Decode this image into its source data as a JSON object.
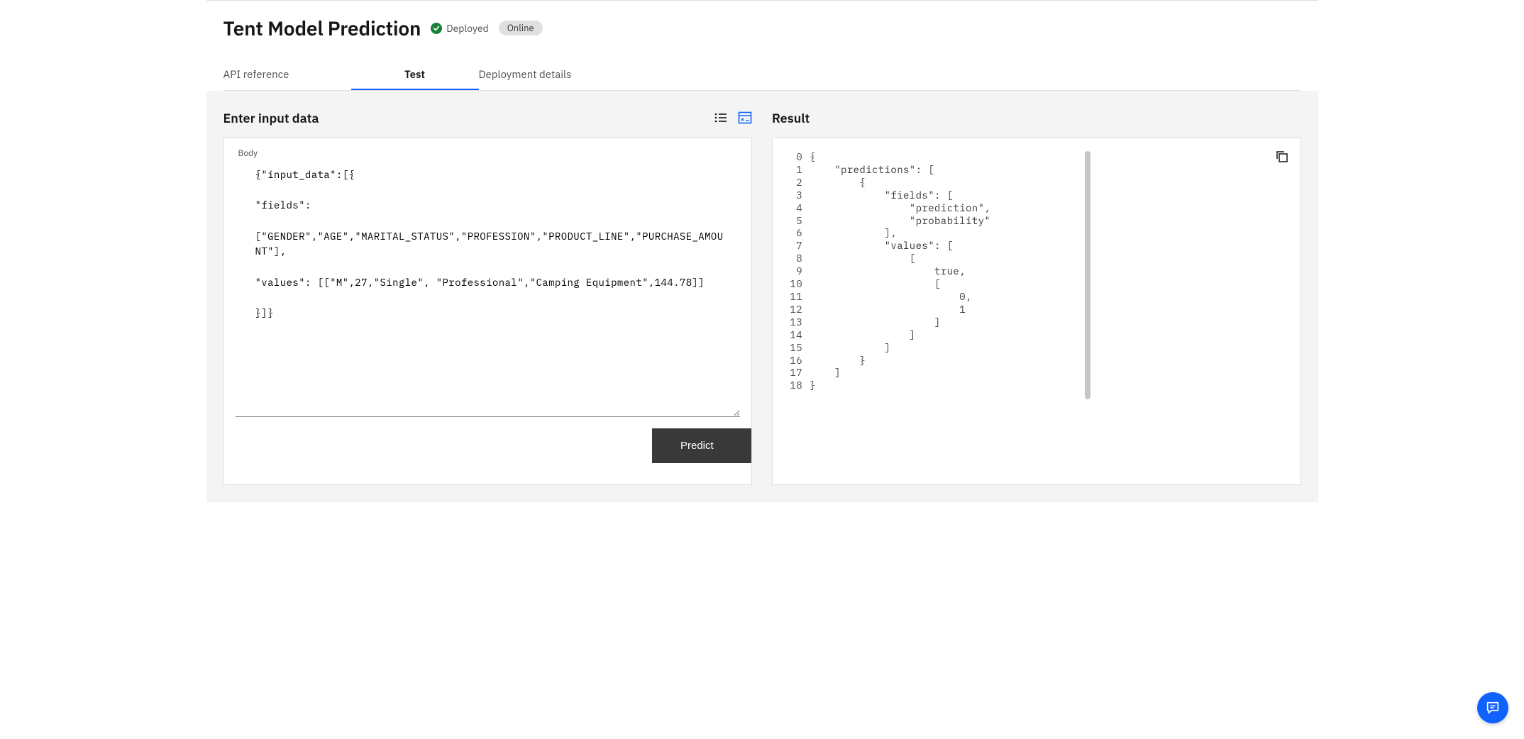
{
  "header": {
    "title": "Tent Model Prediction",
    "deployed_label": "Deployed",
    "online_label": "Online"
  },
  "tabs": {
    "items": [
      {
        "label": "API reference",
        "active": false
      },
      {
        "label": "Test",
        "active": true
      },
      {
        "label": "Deployment details",
        "active": false
      }
    ]
  },
  "input_panel": {
    "title": "Enter input data",
    "body_label": "Body",
    "body_text": "{\"input_data\":[{\n\n\"fields\":\n\n[\"GENDER\",\"AGE\",\"MARITAL_STATUS\",\"PROFESSION\",\"PRODUCT_LINE\",\"PURCHASE_AMOUNT\"],\n\n\"values\": [[\"M\",27,\"Single\", \"Professional\",\"Camping Equipment\",144.78]]\n\n}]}",
    "predict_label": "Predict"
  },
  "result_panel": {
    "title": "Result",
    "lines": [
      "{",
      "    \"predictions\": [",
      "        {",
      "            \"fields\": [",
      "                \"prediction\",",
      "                \"probability\"",
      "            ],",
      "            \"values\": [",
      "                [",
      "                    true,",
      "                    [",
      "                        0,",
      "                        1",
      "                    ]",
      "                ]",
      "            ]",
      "        }",
      "    ]",
      "}"
    ]
  }
}
